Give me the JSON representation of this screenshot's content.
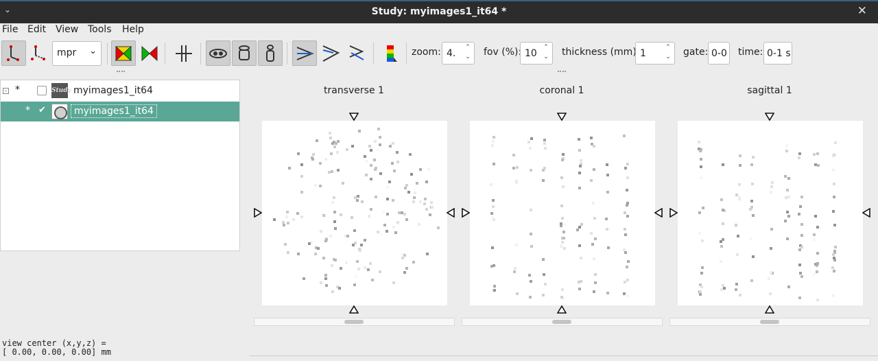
{
  "window": {
    "title": "Study: myimages1_it64 *"
  },
  "menu": [
    "File",
    "Edit",
    "View",
    "Tools",
    "Help"
  ],
  "toolbar": {
    "view_mode": "mpr",
    "zoom_label": "zoom:",
    "zoom_value": "4.",
    "fov_label": "fov (%):",
    "fov_value": "10",
    "thickness_label": "thickness (mm):",
    "thickness_value": "1",
    "gate_label": "gate:",
    "gate_value": "0-0",
    "time_label": "time:",
    "time_value": "0-1 s",
    "icons": [
      "line-profile-icon",
      "roi-tool-icon",
      "target-yellow-icon",
      "target-red-icon",
      "crosshair-icon",
      "fuse-blend-icon",
      "fuse-overlay-icon",
      "fuse-single-icon",
      "view-transverse-icon",
      "view-coronal-icon",
      "view-sagittal-icon",
      "colormap-icon"
    ]
  },
  "tree": {
    "rows": [
      {
        "star": "*",
        "checked": false,
        "label": "myimages1_it64",
        "icon": "study-icon",
        "icon_text": "Study",
        "selected": false
      },
      {
        "star": "*",
        "checked": true,
        "label": "myimages1_it64",
        "icon": "image-icon",
        "selected": true
      }
    ]
  },
  "views": [
    {
      "title": "transverse 1"
    },
    {
      "title": "coronal 1"
    },
    {
      "title": "sagittal 1"
    }
  ],
  "status": {
    "line1": "view center (x,y,z) =",
    "line2": "[ 0.00, 0.00, 0.00] mm"
  }
}
